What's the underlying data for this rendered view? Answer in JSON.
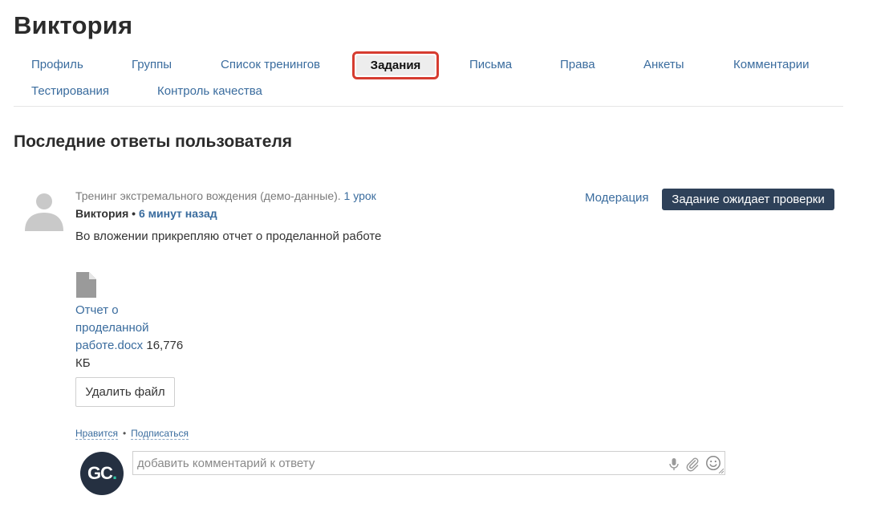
{
  "user": {
    "name": "Виктория"
  },
  "tabs": [
    {
      "label": "Профиль"
    },
    {
      "label": "Группы"
    },
    {
      "label": "Список тренингов"
    },
    {
      "label": "Задания",
      "active": true
    },
    {
      "label": "Письма"
    },
    {
      "label": "Права"
    },
    {
      "label": "Анкеты"
    },
    {
      "label": "Комментарии"
    },
    {
      "label": "Тестирования"
    },
    {
      "label": "Контроль качества"
    }
  ],
  "section_title": "Последние ответы пользователя",
  "answer": {
    "training": "Тренинг экстремального вождения (демо-данные).",
    "lesson_link": "1 урок",
    "author": "Виктория",
    "separator": "•",
    "time": "6 минут назад",
    "moderation_link": "Модерация",
    "status": "Задание ожидает проверки",
    "text": "Во вложении прикрепляю отчет о проделанной работе",
    "file": {
      "name_lines": [
        "Отчет о",
        "проделанной",
        "работе.docx"
      ],
      "size": "16,776",
      "unit": "КБ"
    },
    "delete_button": "Удалить файл",
    "like_link": "Нравится",
    "subscribe_link": "Подписаться"
  },
  "comment": {
    "avatar_text": "GC",
    "avatar_dot": ".",
    "placeholder": "добавить комментарий к ответу"
  },
  "colors": {
    "link": "#3a6c9e",
    "badge_bg": "#2e4159",
    "active_tab_border": "#d63c30",
    "avatar_bg": "#253041",
    "avatar_accent": "#2ec4a5"
  },
  "icons": [
    "user-placeholder-icon",
    "file-icon",
    "microphone-icon",
    "paperclip-icon",
    "smiley-icon"
  ]
}
